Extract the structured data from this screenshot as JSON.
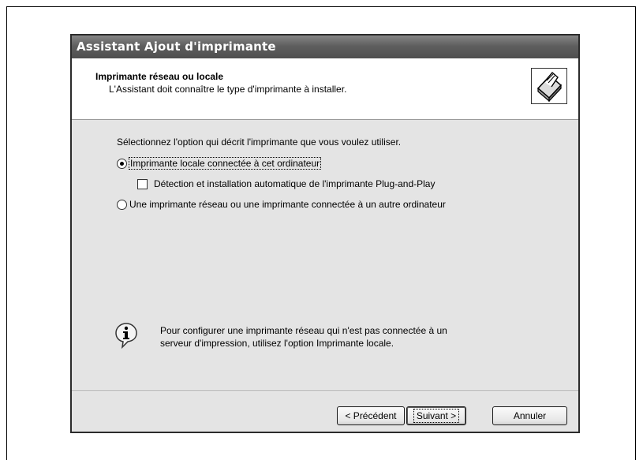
{
  "window": {
    "title": "Assistant Ajout d'imprimante"
  },
  "header": {
    "title": "Imprimante réseau ou locale",
    "subtitle": "L'Assistant doit connaître le type d'imprimante à installer.",
    "icon": "printer-icon"
  },
  "main": {
    "instruction": "Sélectionnez l'option qui décrit l'imprimante que vous voulez utiliser.",
    "options": [
      {
        "label": "Imprimante locale connectée à cet ordinateur",
        "type": "radio",
        "checked": true
      },
      {
        "label": "Détection et installation automatique de l'imprimante Plug-and-Play",
        "type": "checkbox",
        "checked": false
      },
      {
        "label": "Une imprimante réseau ou une imprimante connectée à un autre ordinateur",
        "type": "radio",
        "checked": false
      }
    ],
    "info": {
      "icon": "info-icon",
      "text_line1": "Pour configurer une imprimante réseau qui n'est pas connectée à un",
      "text_line2": "serveur d'impression, utilisez l'option Imprimante locale."
    }
  },
  "buttons": {
    "back": "< Précédent",
    "next": "Suivant >",
    "cancel": "Annuler"
  }
}
